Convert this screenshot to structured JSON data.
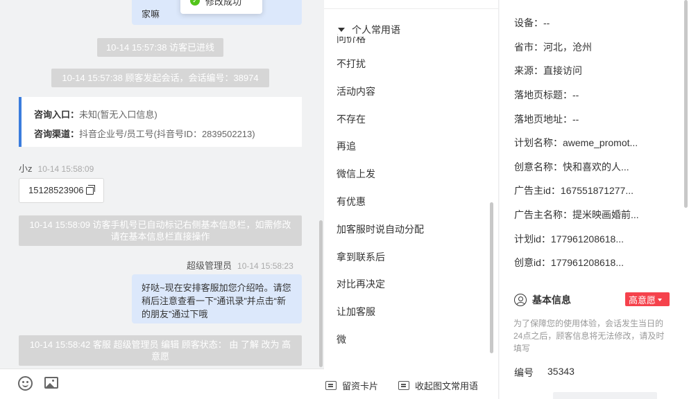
{
  "chat": {
    "top_bubble_text": "家嘛",
    "toast_text": "修改成功",
    "sys_visitor_joined": "10-14 15:57:38 访客已进线",
    "sys_session_started": "10-14 15:57:38 顾客发起会话，会话编号：38974",
    "card": {
      "entry_label": "咨询入口：",
      "entry_value": "未知(暂无入口信息)",
      "channel_label": "咨询渠道：",
      "channel_value": "抖音企业号/员工号(抖音号ID：2839502213)"
    },
    "visitor_name": "小z",
    "visitor_time": "10-14 15:58:09",
    "phone_number": "15128523906",
    "sys_phone_marked": "10-14 15:58:09 访客手机号已自动标记右侧基本信息栏，如需修改请在基本信息栏直接操作",
    "agent_name": "超级管理员",
    "agent_time": "10-14 15:58:23",
    "agent_message": "好哒~现在安排客服加您介绍哈。请您稍后注意查看一下“通讯录”并点击“新的朋友”通过下哦",
    "sys_status_change": "10-14 15:58:42 客服 超级管理员 编辑 顾客状态： 由 了解 改为 高意愿"
  },
  "phrases": {
    "group_title": "个人常用语",
    "clipped_item": "问价格",
    "items": [
      "不打扰",
      "活动内容",
      "不存在",
      "再追",
      "微信上发",
      "有优惠",
      "加客服时说自动分配",
      "拿到联系后",
      "对比再决定",
      "让加客服",
      "微"
    ],
    "toolbar": {
      "card_label": "留资卡片",
      "collapse_label": "收起图文常用语"
    }
  },
  "visitor_info": {
    "fields": [
      {
        "label": "设备：",
        "value": "--"
      },
      {
        "label": "省市：",
        "value": "河北，沧州"
      },
      {
        "label": "来源：",
        "value": "直接访问"
      },
      {
        "label": "落地页标题：",
        "value": "--"
      },
      {
        "label": "落地页地址：",
        "value": "--"
      },
      {
        "label": "计划名称：",
        "value": "aweme_promot..."
      },
      {
        "label": "创意名称：",
        "value": "快和喜欢的人..."
      },
      {
        "label": "广告主id：",
        "value": "167551871277..."
      },
      {
        "label": "广告主名称：",
        "value": "提米映画婚前..."
      },
      {
        "label": "计划id：",
        "value": "177961208618..."
      },
      {
        "label": "创意id：",
        "value": "177961208618..."
      }
    ],
    "basic_info_title": "基本信息",
    "intent_badge": "高意愿",
    "notice": "为了保障您的使用体验，会话发生当日的24点之后，顾客信息将无法修改，请及时填写",
    "id_label": "编号",
    "id_value": "35343"
  },
  "colors": {
    "accent": "#3b7ddd",
    "agent_bubble": "#dce8fb",
    "intent_badge": "#f5424c",
    "success": "#52c41a"
  }
}
